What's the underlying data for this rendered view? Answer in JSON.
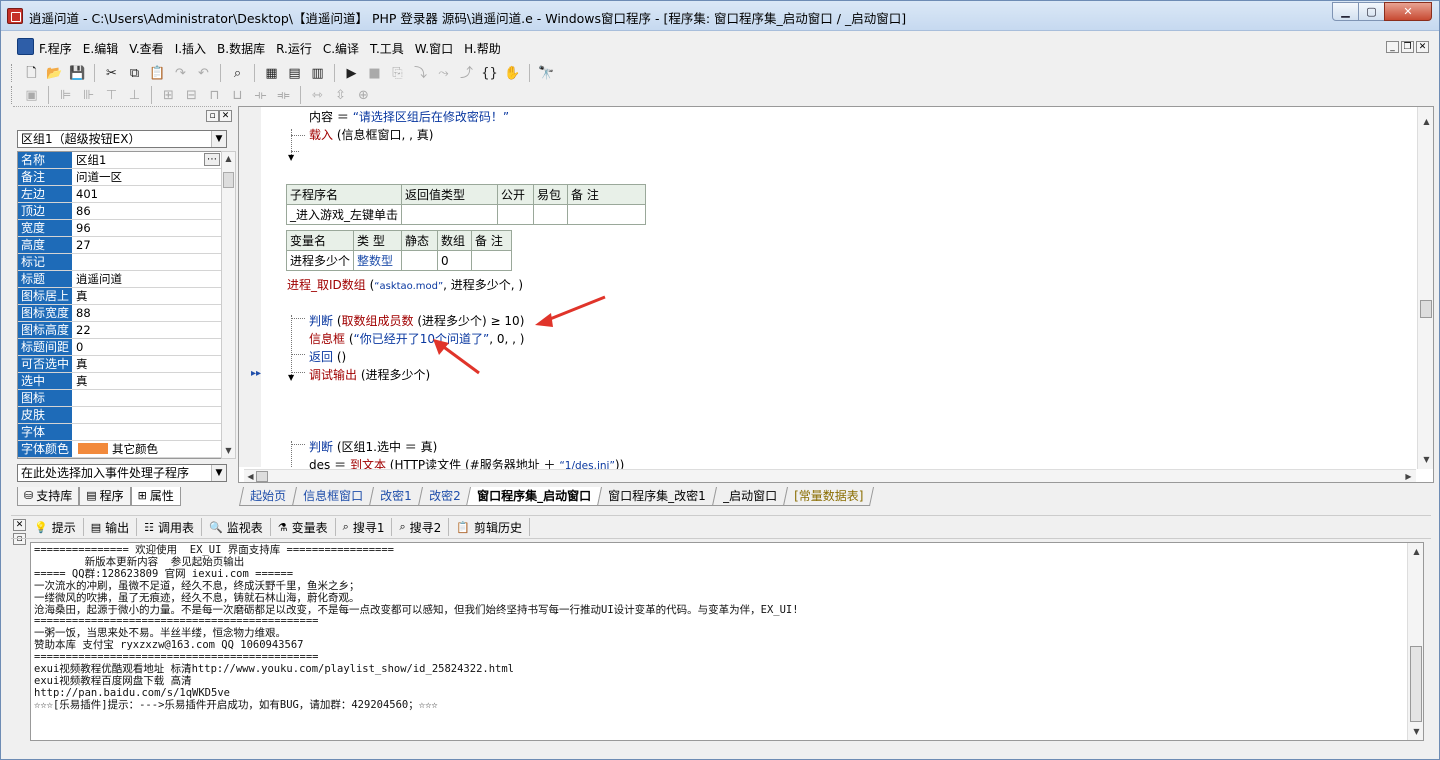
{
  "window": {
    "title": "逍遥问道 - C:\\Users\\Administrator\\Desktop\\【逍遥问道】 PHP 登录器 源码\\逍遥问道.e - Windows窗口程序 - [程序集: 窗口程序集_启动窗口 / _启动窗口]"
  },
  "menu": {
    "items": [
      "F.程序",
      "E.编辑",
      "V.查看",
      "I.插入",
      "B.数据库",
      "R.运行",
      "C.编译",
      "T.工具",
      "W.窗口",
      "H.帮助"
    ]
  },
  "property_panel": {
    "object": "区组1（超级按钮EX）",
    "rows": [
      {
        "name": "名称",
        "value": "区组1"
      },
      {
        "name": "备注",
        "value": "问道一区"
      },
      {
        "name": "左边",
        "value": "401"
      },
      {
        "name": "顶边",
        "value": "86"
      },
      {
        "name": "宽度",
        "value": "96"
      },
      {
        "name": "高度",
        "value": "27"
      },
      {
        "name": "标记",
        "value": ""
      },
      {
        "name": "标题",
        "value": "逍遥问道"
      },
      {
        "name": "图标居上",
        "value": "真"
      },
      {
        "name": "图标宽度",
        "value": "88"
      },
      {
        "name": "图标高度",
        "value": "22"
      },
      {
        "name": "标题间距",
        "value": "0"
      },
      {
        "name": "可否选中",
        "value": "真"
      },
      {
        "name": "选中",
        "value": "真"
      },
      {
        "name": "图标",
        "value": ""
      },
      {
        "name": "皮肤",
        "value": ""
      },
      {
        "name": "字体",
        "value": ""
      },
      {
        "name": "字体颜色",
        "value": "其它颜色"
      }
    ],
    "font_color_swatch": "#f28a3c",
    "event_select": "在此处选择加入事件处理子程序",
    "tabs": [
      "支持库",
      "程序",
      "属性"
    ]
  },
  "code": {
    "line1_key": "内容",
    "line1_op": "＝",
    "line1_str": "“请选择区组后在修改密码！”",
    "line2_kw": "载入",
    "line2_rest": "(信息框窗口, , 真)",
    "sub_table": {
      "headers": [
        "子程序名",
        "返回值类型",
        "公开",
        "易包",
        "备 注"
      ],
      "row": [
        "_进入游戏_左键单击",
        "",
        "",
        "",
        ""
      ]
    },
    "var_table": {
      "headers": [
        "变量名",
        "类 型",
        "静态",
        "数组",
        "备 注"
      ],
      "row": [
        "进程多少个",
        "整数型",
        "",
        "0",
        ""
      ]
    },
    "line3_kw": "进程_取ID数组",
    "line3_open": "(",
    "line3_str": "“asktao.mod”",
    "line3_rest": ", 进程多少个, )",
    "if1_kw": "判断",
    "if1_open": "(",
    "if1_fn": "取数组成员数",
    "if1_rest": "(进程多少个) ≥ 10)",
    "msg_kw": "信息框",
    "msg_open": "(",
    "msg_str": "“你已经开了10个问道了”",
    "msg_rest": ", 0, , )",
    "ret_kw": "返回",
    "ret_rest": "()",
    "dbg_kw": "调试输出",
    "dbg_rest": "(进程多少个)",
    "if2_kw": "判断",
    "if2_rest": "(区组1.选中 ＝ 真)",
    "des_key": "des",
    "des_op": "＝",
    "des_kw": "到文本",
    "des_mid": "(HTTP读文件 (#服务器地址 ＋ ",
    "des_str": "“1/des.ini”",
    "des_end": "))"
  },
  "editor_tabs": [
    "起始页",
    "信息框窗口",
    "改密1",
    "改密2",
    "窗口程序集_启动窗口",
    "窗口程序集_改密1",
    "_启动窗口",
    "[常量数据表]"
  ],
  "bottom_tabs": [
    "提示",
    "输出",
    "调用表",
    "监视表",
    "变量表",
    "搜寻1",
    "搜寻2",
    "剪辑历史"
  ],
  "output_lines": [
    "=============== 欢迎使用  EX_UI 界面支持库 =================",
    "        新版本更新内容  参见起始页输出",
    "===== QQ群:128623809 官网 iexui.com ======",
    "一次流水的冲刷，虽微不足道，经久不息，终成沃野千里，鱼米之乡；",
    "一缕微风的吹拂，虽了无痕迹，经久不息，铸就石林山海，蔚化奇观。",
    "沧海桑田，起源于微小的力量。不是每一次磨砺都足以改变，不是每一点改变都可以感知，但我们始终坚持书写每一行推动UI设计变革的代码。与变革为伴，EX_UI!",
    "=============================================",
    "一粥一饭，当思来处不易。半丝半缕，恒念物力维艰。",
    "赞助本库 支付宝 ryxzxzw@163.com QQ 1060943567",
    "=============================================",
    "exui视频教程优酷观看地址 标清http://www.youku.com/playlist_show/id_25824322.html",
    "exui视频教程百度网盘下载 高清",
    "http://pan.baidu.com/s/1qWKD5ve",
    "☆☆☆[乐易插件]提示：--->乐易插件开启成功，如有BUG，请加群：429204560；☆☆☆"
  ],
  "colors": {
    "keyword": "#a00000",
    "string": "#0a38a0",
    "annotation_arrow": "#e0342a",
    "property_name_bg": "#1e6bb8"
  }
}
